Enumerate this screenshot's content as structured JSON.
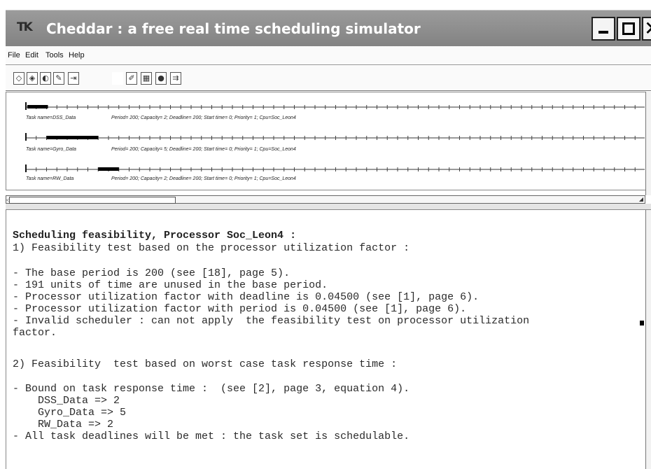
{
  "window": {
    "title": "Cheddar : a free real time scheduling simulator",
    "logo_text": "TK",
    "minimize_icon": "minimize-icon",
    "maximize_icon": "maximize-icon",
    "close_icon": "close-icon"
  },
  "menu": [
    "File",
    "Edit",
    "Tools",
    "Help"
  ],
  "toolbar": {
    "icons": [
      "new-file-icon",
      "open-file-icon",
      "save-file-icon",
      "edit-icon",
      "import-icon",
      "run-icon",
      "analysis-icon",
      "simulate-icon",
      "export-icon"
    ]
  },
  "gantt": {
    "time_units": 200,
    "tasks": [
      {
        "label": "Task name=DSS_Data",
        "info": "Period= 200; Capacity= 2; Deadline= 200; Start time= 0; Priority= 1; Cpu=Soc_Leon4",
        "exec_start": 0,
        "exec_end": 2
      },
      {
        "label": "Task name=Gyro_Data",
        "info": "Period= 200; Capacity= 5; Deadline= 200; Start time= 0; Priority= 1; Cpu=Soc_Leon4",
        "exec_start": 2,
        "exec_end": 7
      },
      {
        "label": "Task name=RW_Data",
        "info": "Period= 200; Capacity= 2; Deadline= 200; Start time= 0; Priority= 1; Cpu=Soc_Leon4",
        "exec_start": 7,
        "exec_end": 9
      }
    ]
  },
  "report": {
    "lines": [
      "Scheduling feasibility, Processor Soc_Leon4 :",
      "1) Feasibility test based on the processor utilization factor :",
      "",
      "- The base period is 200 (see [18], page 5).",
      "- 191 units of time are unused in the base period.",
      "- Processor utilization factor with deadline is 0.04500 (see [1], page 6).",
      "- Processor utilization factor with period is 0.04500 (see [1], page 6).",
      "- Invalid scheduler : can not apply  the feasibility test on processor utilization",
      "factor.",
      "",
      "2) Feasibility  test based on worst case task response time :",
      "",
      "- Bound on task response time :  (see [2], page 3, equation 4).",
      "    DSS_Data => 2",
      "    Gyro_Data => 5",
      "    RW_Data => 2",
      "- All task deadlines will be met : the task set is schedulable."
    ]
  }
}
